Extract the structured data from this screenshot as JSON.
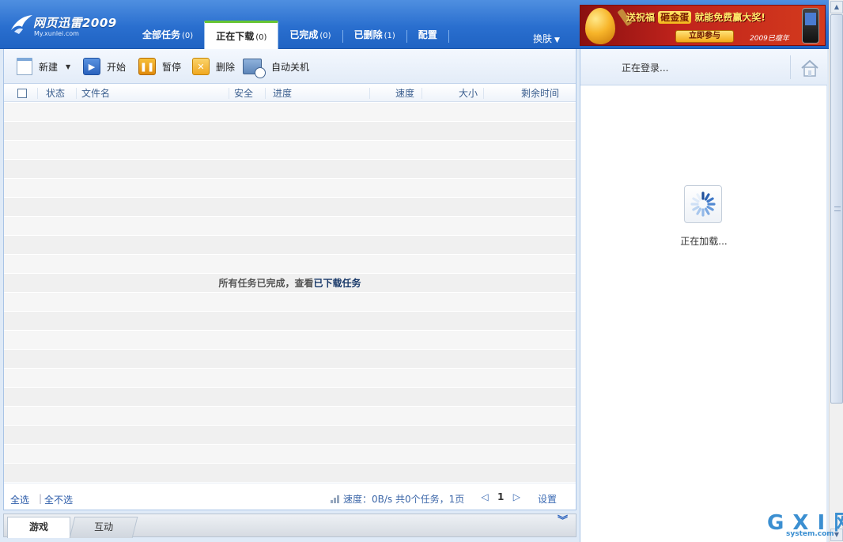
{
  "app": {
    "logo_title": "网页迅雷2009",
    "logo_domain": "My.xunlei.com"
  },
  "tabs": [
    {
      "label": "全部任务",
      "count": "(0)",
      "active": false
    },
    {
      "label": "正在下载",
      "count": "(0)",
      "active": true
    },
    {
      "label": "已完成",
      "count": "(0)",
      "active": false
    },
    {
      "label": "已删除",
      "count": "(1)",
      "active": false
    },
    {
      "label": "配置",
      "count": "",
      "active": false
    }
  ],
  "skin_label": "换肤",
  "banner": {
    "headline_pre": "送祝福",
    "headline_hl": "砸金蛋",
    "headline_post": "就能免费赢大奖!",
    "button_label": "立即参与",
    "brand": "2009已瘦年"
  },
  "toolbar": {
    "new_label": "新建",
    "start_label": "开始",
    "pause_label": "暂停",
    "delete_label": "删除",
    "shutdown_label": "自动关机"
  },
  "columns": {
    "status": "状态",
    "filename": "文件名",
    "security": "安全",
    "progress": "进度",
    "speed": "速度",
    "size": "大小",
    "remaining": "剩余时间"
  },
  "empty_message": {
    "prefix": "所有任务已完成，查看",
    "link": "已下载任务"
  },
  "footer": {
    "select_all": "全选",
    "separator": "|",
    "select_none": "全不选",
    "speed_text": "速度：0B/s 共0个任务，1页",
    "current_page": "1",
    "settings_label": "设置"
  },
  "bottom_tabs": {
    "games": "游戏",
    "interact": "互动"
  },
  "right_panel": {
    "login_text": "正在登录...",
    "loading_text": "正在加载..."
  },
  "watermark": {
    "big": "G X I 网",
    "small": "system.com"
  },
  "colors": {
    "header_blue": "#2a6fcf",
    "active_tab_accent": "#66c533",
    "link_blue": "#2a5aa8"
  }
}
